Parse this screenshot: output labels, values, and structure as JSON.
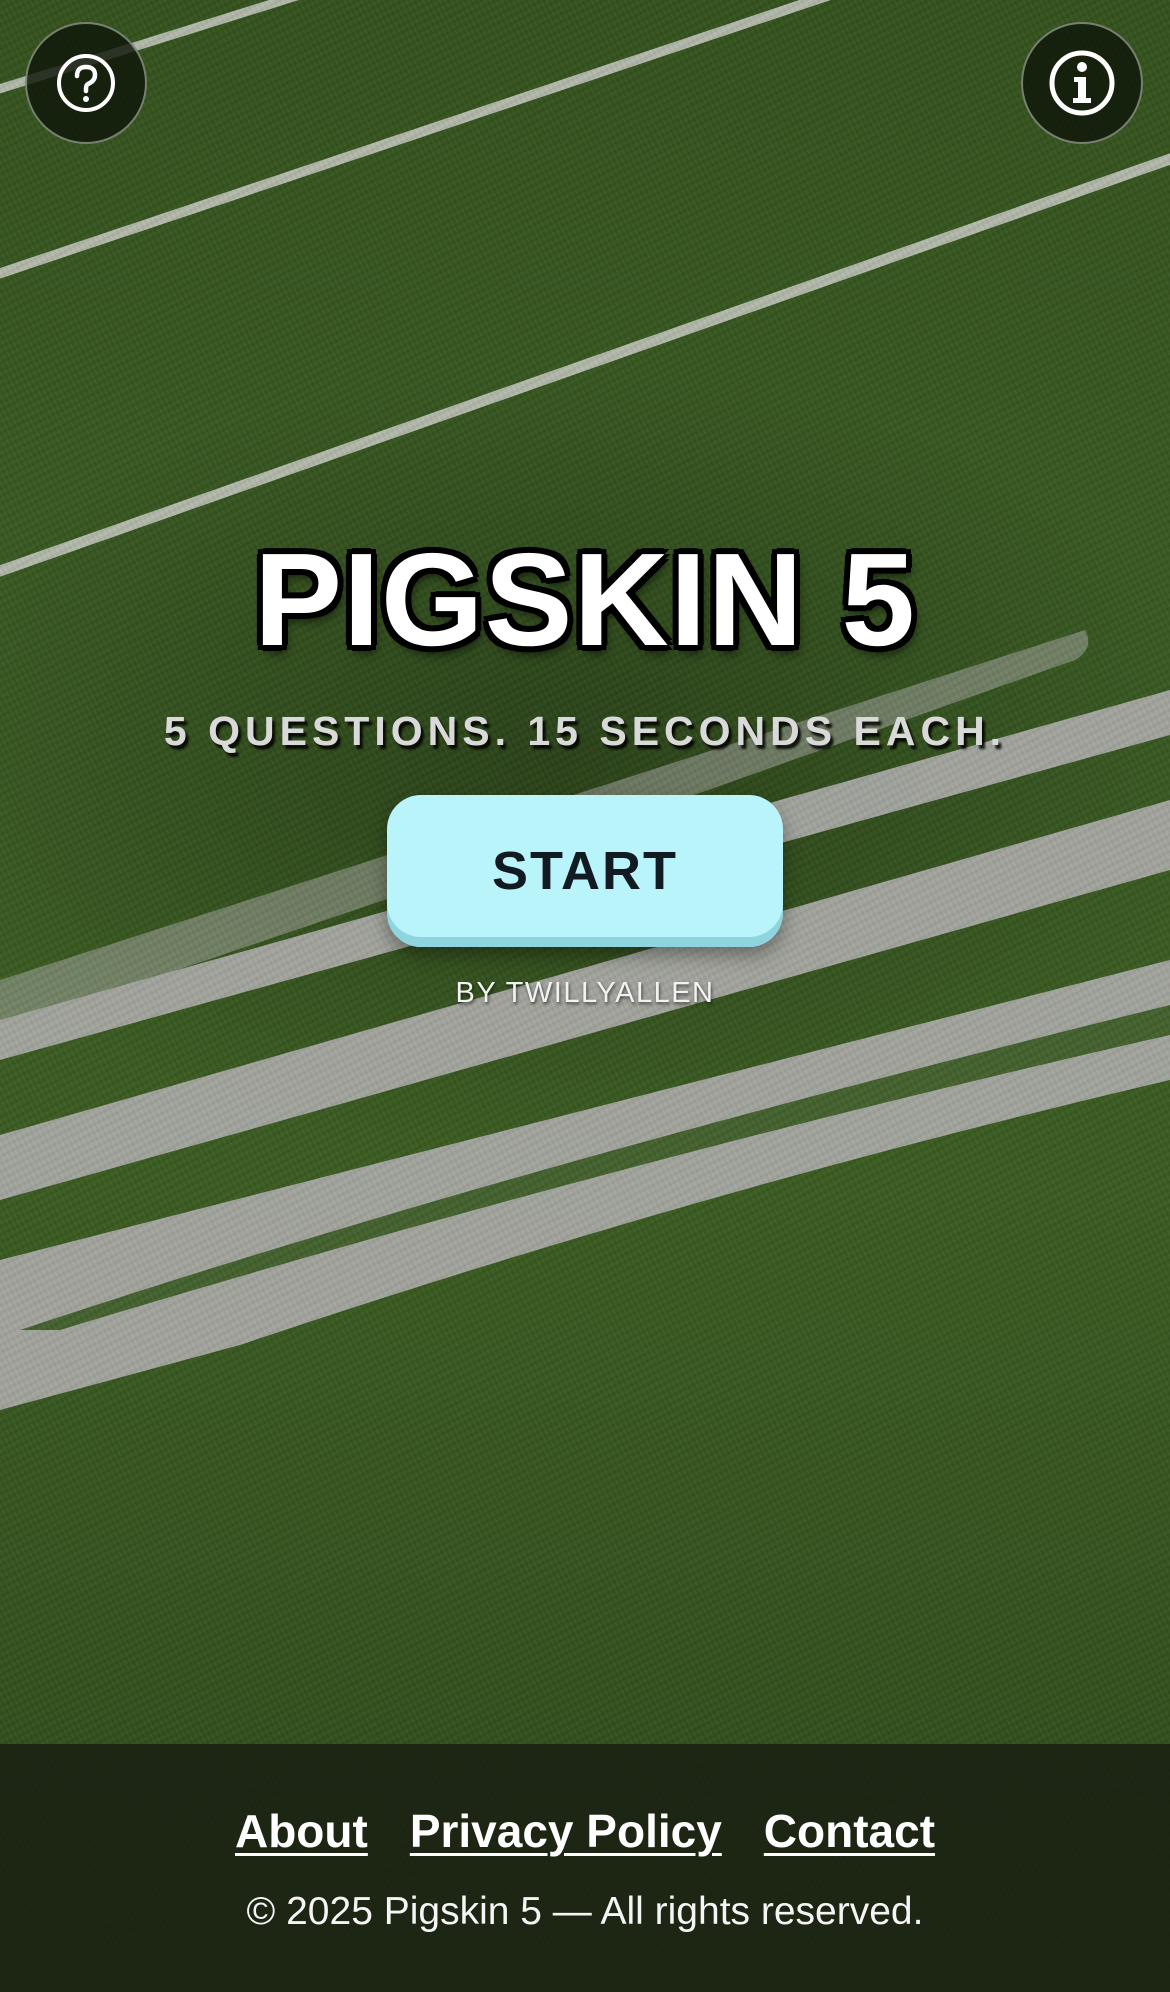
{
  "header": {
    "help_icon": "question-circle-icon",
    "info_icon": "info-circle-icon"
  },
  "hero": {
    "title": "PIGSKIN 5",
    "tagline": "5 QUESTIONS. 15 SECONDS EACH.",
    "start_label": "START",
    "byline": "BY TWILLYALLEN"
  },
  "footer": {
    "links": [
      {
        "label": "About"
      },
      {
        "label": "Privacy Policy"
      },
      {
        "label": "Contact"
      }
    ],
    "copyright": "© 2025 Pigskin 5 — All rights reserved."
  },
  "colors": {
    "turf": "#3a5b22",
    "start_button": "#b9f4fb",
    "footer_bg": "#1a2012"
  }
}
